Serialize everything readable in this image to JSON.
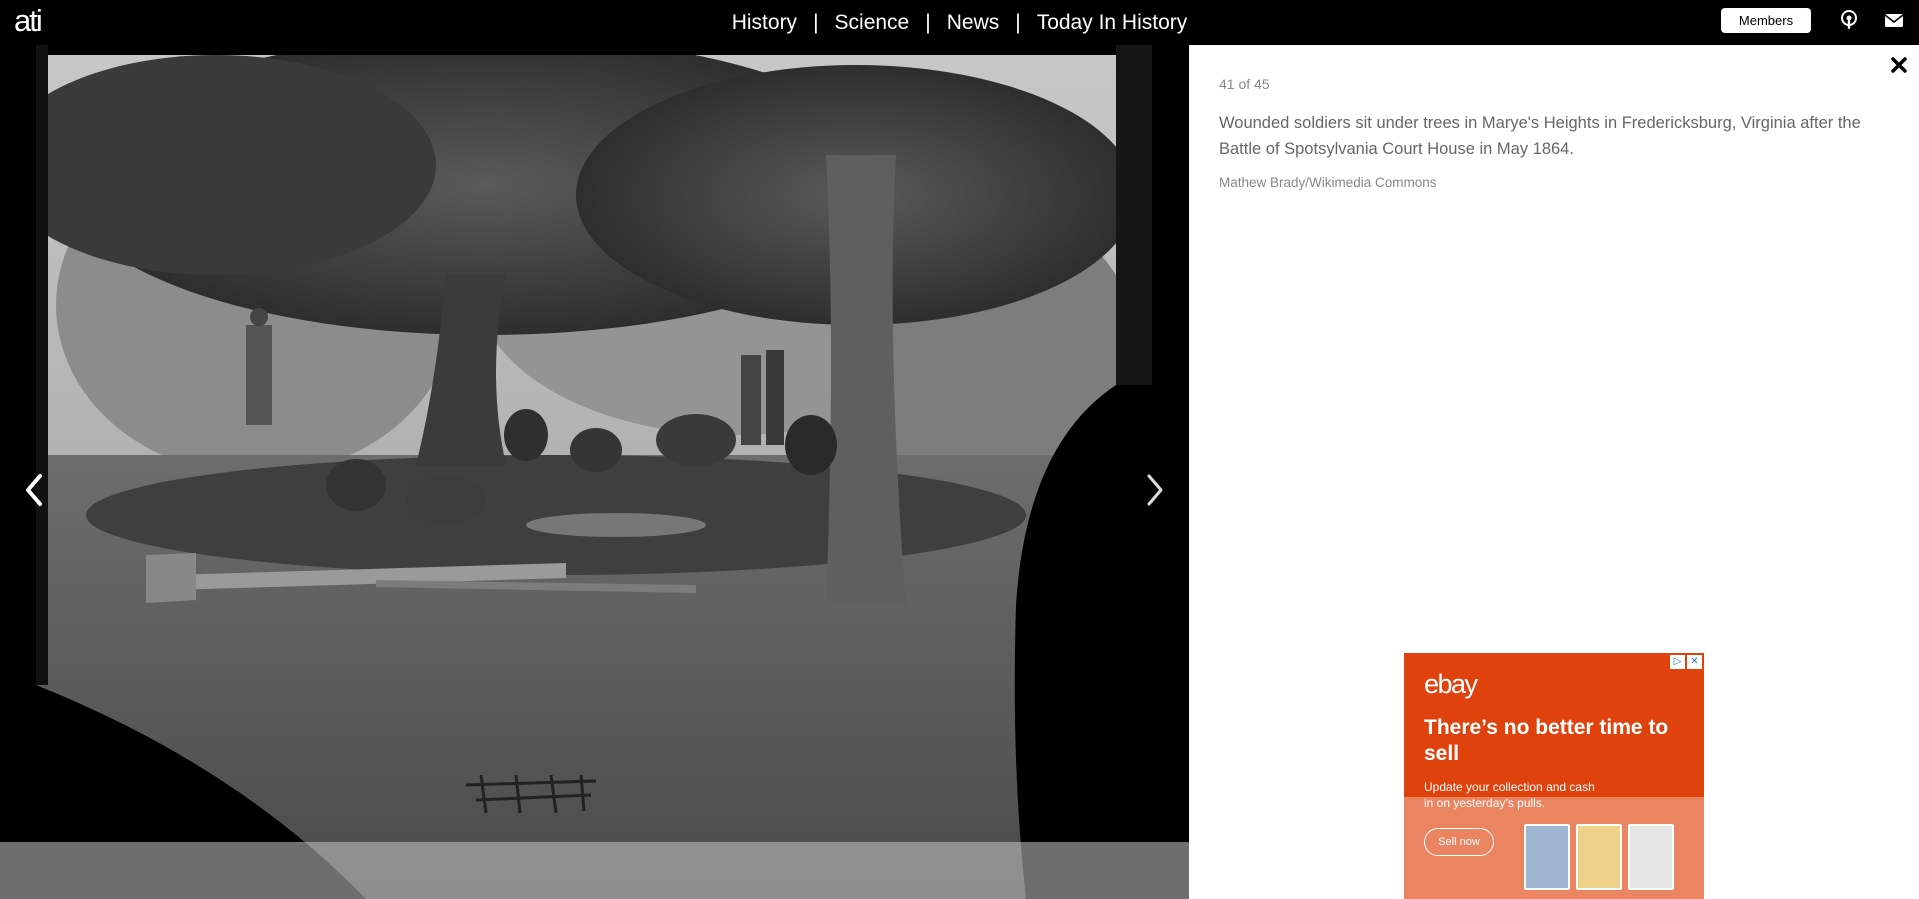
{
  "header": {
    "logo": "ati",
    "nav": [
      {
        "label": "History"
      },
      {
        "label": "Science"
      },
      {
        "label": "News"
      },
      {
        "label": "Today In History"
      }
    ],
    "nav_separator": "|",
    "members_label": "Members",
    "icons": [
      "podcast-icon",
      "mail-icon"
    ]
  },
  "gallery": {
    "prev_icon": "chevron-left-icon",
    "next_icon": "chevron-right-icon"
  },
  "panel": {
    "close_icon": "close-icon",
    "counter": "41 of 45",
    "caption": "Wounded soldiers sit under trees in Marye's Heights in Fredericksburg, Virginia after the Battle of Spotsylvania Court House in May 1864.",
    "credit": "Mathew Brady/Wikimedia Commons"
  },
  "ad": {
    "brand": "ebay",
    "headline": "There’s no better time to sell",
    "body": "Update your collection and cash in on yesterday’s pulls.",
    "cta": "Sell now",
    "controls": [
      "▷",
      "✕"
    ]
  },
  "colors": {
    "ad_background": "#e0420d",
    "panel_background": "#ffffff",
    "topbar_background": "#000000"
  }
}
